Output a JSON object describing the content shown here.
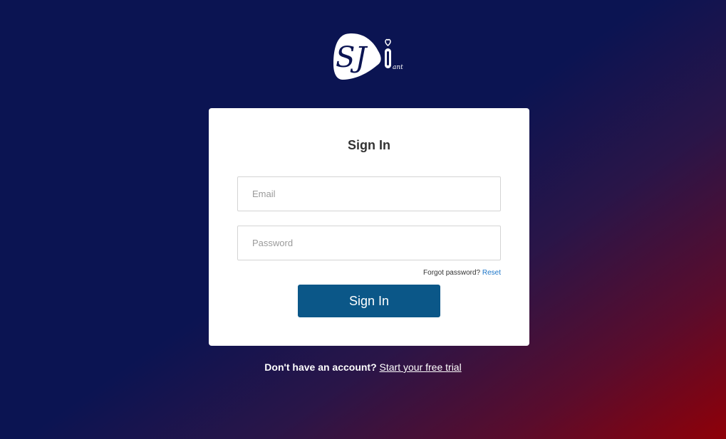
{
  "logo": {
    "text": "SJ",
    "superscript": "i",
    "suffix": "ant"
  },
  "card": {
    "title": "Sign In",
    "email_placeholder": "Email",
    "email_value": "",
    "password_placeholder": "Password",
    "password_value": "",
    "forgot_text": "Forgot password?",
    "reset_link": "Reset",
    "signin_button": "Sign In"
  },
  "footer": {
    "question": "Don't have an account?",
    "trial_link": "Start your free trial"
  },
  "colors": {
    "background_top": "#0b1452",
    "background_bottom_right": "#8f0008",
    "button": "#0b5788",
    "link": "#1a74c8"
  }
}
